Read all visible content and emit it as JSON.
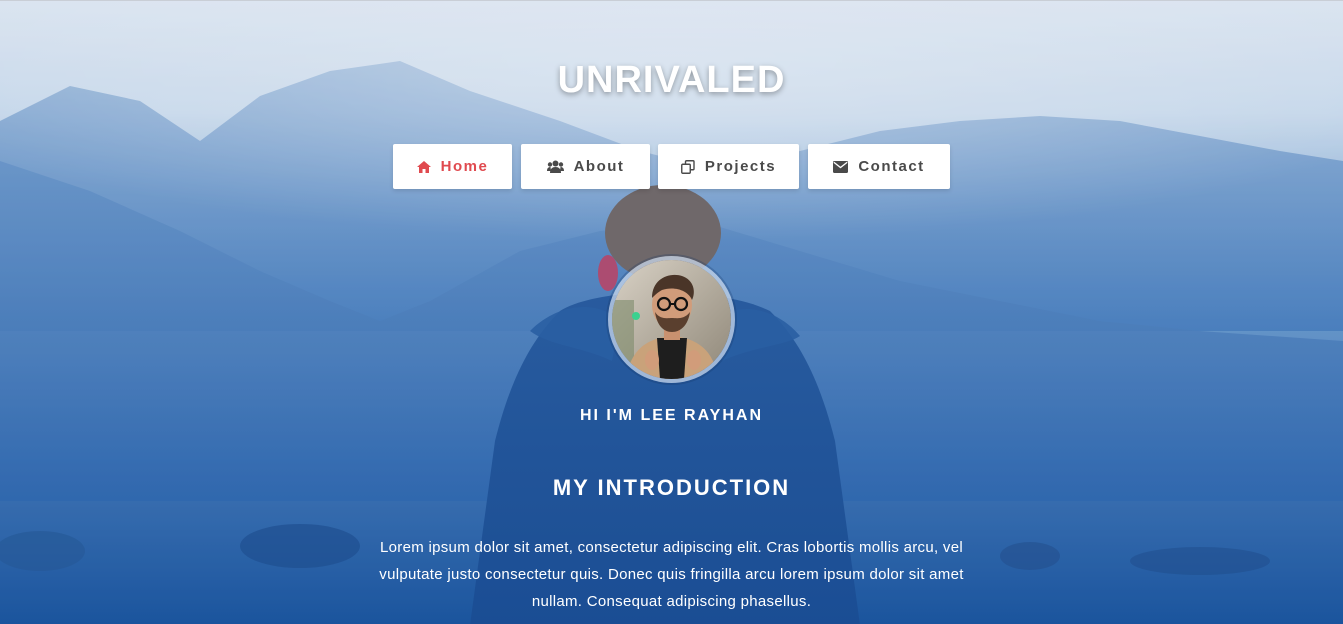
{
  "site": {
    "title": "UNRIVALED"
  },
  "nav": {
    "items": [
      {
        "label": "Home",
        "icon": "home-icon",
        "active": true
      },
      {
        "label": "About",
        "icon": "users-icon",
        "active": false
      },
      {
        "label": "Projects",
        "icon": "copy-icon",
        "active": false
      },
      {
        "label": "Contact",
        "icon": "envelope-icon",
        "active": false
      }
    ]
  },
  "profile": {
    "greeting": "HI I'M LEE RAYHAN",
    "avatar_icon": "profile-photo"
  },
  "intro": {
    "heading": "MY INTRODUCTION",
    "text": "Lorem ipsum dolor sit amet, consectetur adipiscing elit. Cras lobortis mollis arcu, vel vulputate justo consectetur quis. Donec quis fringilla arcu lorem ipsum dolor sit amet nullam. Consequat adipiscing phasellus."
  },
  "colors": {
    "active_nav": "#e04a4f",
    "nav_text": "#4a4a4a",
    "overlay_blue": "#1d5aa3"
  }
}
